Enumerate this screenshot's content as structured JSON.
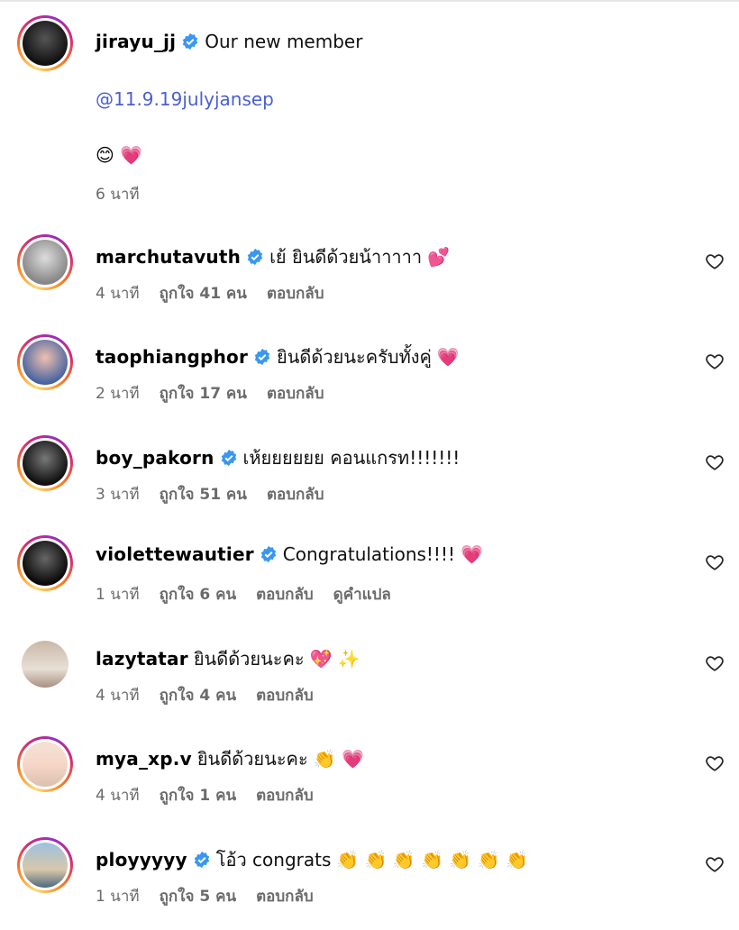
{
  "post": {
    "username": "jirayu_jj",
    "caption": "Our new member",
    "mention": "@11.9.19julyjansep",
    "emojis": "😊 💗",
    "time": "6 นาที"
  },
  "comments": [
    {
      "username": "marchutavuth",
      "text": "เย้ ยินดีด้วยน้าาาาา",
      "emoji": "💕",
      "time": "4 นาที",
      "likes": "ถูกใจ 41 คน",
      "reply": "ตอบกลับ"
    },
    {
      "username": "taophiangphor",
      "text": "ยินดีด้วยนะครับทั้งคู่",
      "emoji": "💗",
      "time": "2 นาที",
      "likes": "ถูกใจ 17 คน",
      "reply": "ตอบกลับ"
    },
    {
      "username": "boy_pakorn",
      "text": "เห้ยยยยยย คอนแกรท!!!!!!!",
      "emoji": "",
      "time": "3 นาที",
      "likes": "ถูกใจ 51 คน",
      "reply": "ตอบกลับ"
    },
    {
      "username": "violettewautier",
      "text": "Congratulations!!!!",
      "emoji": "💗",
      "time": "1 นาที",
      "likes": "ถูกใจ 6 คน",
      "reply": "ตอบกลับ",
      "translate": "ดูคำแปล"
    },
    {
      "username": "lazytatar",
      "text": "ยินดีด้วยนะคะ",
      "emoji": "💖 ✨",
      "time": "4 นาที",
      "likes": "ถูกใจ 4 คน",
      "reply": "ตอบกลับ"
    },
    {
      "username": "mya_xp.v",
      "text": "ยินดีด้วยนะคะ",
      "emoji": "👏 💗",
      "time": "4 นาที",
      "likes": "ถูกใจ 1 คน",
      "reply": "ตอบกลับ"
    },
    {
      "username": "ployyyyy",
      "text": "โอ้ว congrats",
      "emoji": "👏 👏 👏 👏 👏 👏 👏",
      "time": "1 นาที",
      "likes": "ถูกใจ 5 คน",
      "reply": "ตอบกลับ"
    }
  ],
  "colors": {
    "verified": "#3897f0",
    "mention": "#4a5fd4",
    "meta": "#6b6b6b"
  }
}
